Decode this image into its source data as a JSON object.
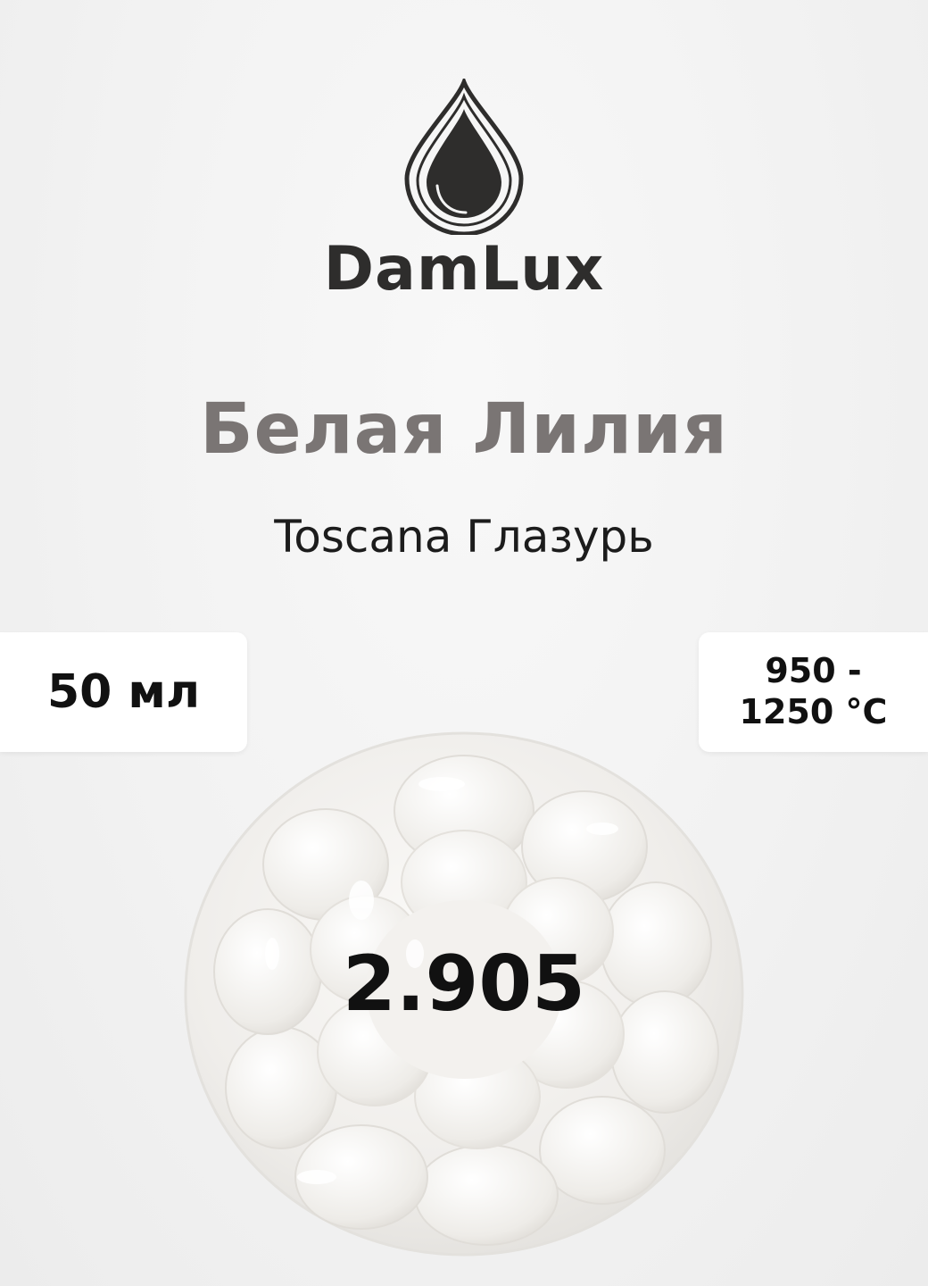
{
  "brand": {
    "name": "DamLux",
    "logo_icon": "drop-icon"
  },
  "product": {
    "name": "Белая Лилия",
    "subtitle": "Toscana Глазурь",
    "code": "2.905"
  },
  "badges": {
    "volume": "50 мл",
    "temperature_line1": "950 -",
    "temperature_line2": "1250 °C"
  },
  "colors": {
    "background": "#f2f2f2",
    "brand_text": "#2e2d2c",
    "product_title": "#7a7574",
    "glaze": "#f1efec"
  }
}
